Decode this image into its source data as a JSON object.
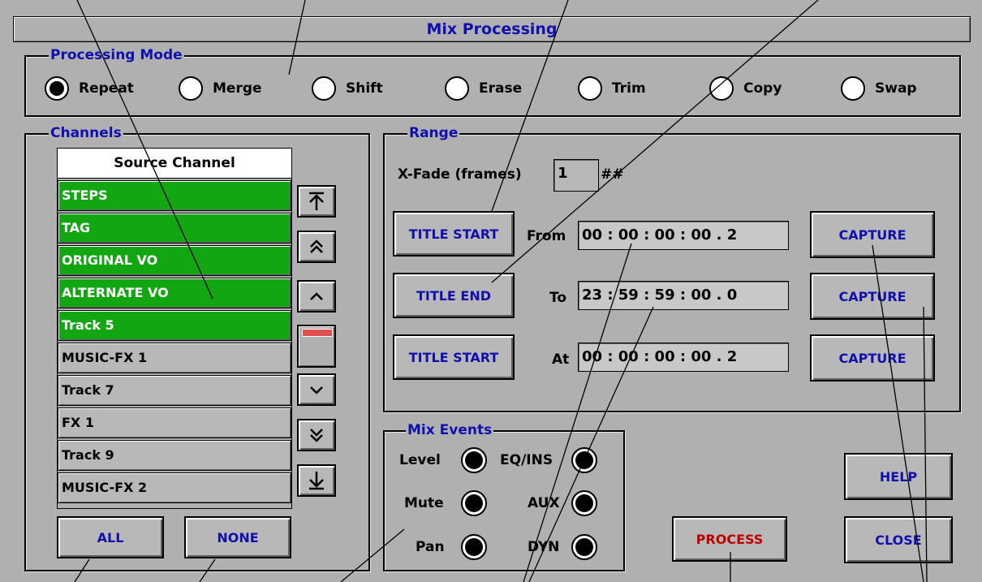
{
  "window": {
    "title": "Mix Processing"
  },
  "processing_mode": {
    "label": "Processing Mode",
    "options": [
      "Repeat",
      "Merge",
      "Shift",
      "Erase",
      "Trim",
      "Copy",
      "Swap"
    ],
    "selected": "Repeat"
  },
  "channels": {
    "label": "Channels",
    "header": "Source Channel",
    "items": [
      {
        "name": "STEPS",
        "selected": true
      },
      {
        "name": "TAG",
        "selected": true
      },
      {
        "name": "ORIGINAL VO",
        "selected": true
      },
      {
        "name": "ALTERNATE VO",
        "selected": true
      },
      {
        "name": "Track  5",
        "selected": true
      },
      {
        "name": "MUSIC-FX 1",
        "selected": false
      },
      {
        "name": "Track  7",
        "selected": false
      },
      {
        "name": "FX 1",
        "selected": false
      },
      {
        "name": "Track  9",
        "selected": false
      },
      {
        "name": "MUSIC-FX 2",
        "selected": false
      }
    ],
    "scroll_icons": [
      "scroll-top-icon",
      "page-up-icon",
      "line-up-icon",
      "line-down-icon",
      "page-down-icon",
      "scroll-bottom-icon"
    ],
    "all_label": "ALL",
    "none_label": "NONE"
  },
  "range": {
    "label": "Range",
    "xfade_label": "X-Fade (frames)",
    "xfade_value": "1",
    "xfade_suffix": "##",
    "rows": [
      {
        "button": "TITLE START",
        "label": "From",
        "time": "00 : 00 : 00 : 00 . 2",
        "capture": "CAPTURE"
      },
      {
        "button": "TITLE END",
        "label": "To",
        "time": "23 : 59 : 59 : 00 . 0",
        "capture": "CAPTURE"
      },
      {
        "button": "TITLE START",
        "label": "At",
        "time": "00 : 00 : 00 : 00 . 2",
        "capture": "CAPTURE"
      }
    ]
  },
  "mix_events": {
    "label": "Mix Events",
    "left": [
      "Level",
      "Mute",
      "Pan"
    ],
    "right": [
      "EQ/INS",
      "AUX",
      "DYN"
    ]
  },
  "buttons": {
    "process": "PROCESS",
    "help": "HELP",
    "close": "CLOSE"
  },
  "colors": {
    "label_blue": "#1010b0",
    "selected_green": "#13a613",
    "process_red": "#c00000",
    "panel_gray": "#b0b0b0"
  }
}
